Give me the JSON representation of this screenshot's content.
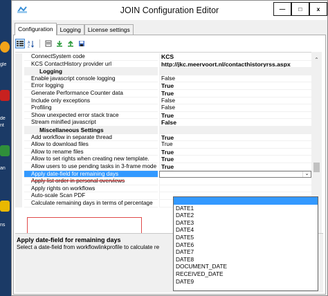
{
  "window": {
    "title": "JOIN Configuration Editor",
    "minimize_glyph": "—",
    "maximize_glyph": "□",
    "close_glyph": "x"
  },
  "tabs": [
    {
      "label": "Configuration",
      "active": true
    },
    {
      "label": "Logging",
      "active": false
    },
    {
      "label": "License settings",
      "active": false
    }
  ],
  "toolbar": {
    "icons": [
      "categorized-view-icon",
      "alphabetical-sort-icon",
      "property-pages-icon",
      "import-icon",
      "export-icon",
      "save-icon"
    ]
  },
  "grid": {
    "rows": [
      {
        "type": "prop",
        "name": "ConnectSystem code",
        "value": "KCS",
        "bold": true
      },
      {
        "type": "prop",
        "name": "KCS ContactHistory provider url",
        "value": "http://jkc.meervoort.nl/contacthistoryrss.aspx",
        "bold": true
      },
      {
        "type": "cat",
        "name": "Logging",
        "value": ""
      },
      {
        "type": "prop",
        "name": "Enable javascript console logging",
        "value": "False",
        "bold": false
      },
      {
        "type": "prop",
        "name": "Error logging",
        "value": "True",
        "bold": true
      },
      {
        "type": "prop",
        "name": "Generate Performance Counter data",
        "value": "True",
        "bold": true
      },
      {
        "type": "prop",
        "name": "Include only exceptions",
        "value": "False",
        "bold": false
      },
      {
        "type": "prop",
        "name": "Profiling",
        "value": "False",
        "bold": false
      },
      {
        "type": "prop",
        "name": "Show unexpected error stack trace",
        "value": "True",
        "bold": true
      },
      {
        "type": "prop",
        "name": "Stream minified javascript",
        "value": "False",
        "bold": true
      },
      {
        "type": "cat",
        "name": "Miscellaneous Settings",
        "value": ""
      },
      {
        "type": "prop",
        "name": "Add workflow in separate thread",
        "value": "True",
        "bold": true
      },
      {
        "type": "prop",
        "name": "Allow to download files",
        "value": "True",
        "bold": false
      },
      {
        "type": "prop",
        "name": "Allow to rename files",
        "value": "True",
        "bold": true
      },
      {
        "type": "prop",
        "name": "Allow to set rights when creating new template.",
        "value": "True",
        "bold": true
      },
      {
        "type": "prop",
        "name": "Allow users to use pending tasks in 3-frame mode",
        "value": "True",
        "bold": true
      },
      {
        "type": "prop",
        "name": "Apply date-field for remaining days",
        "value": "",
        "bold": false,
        "selected": true
      },
      {
        "type": "prop",
        "name": "Apply list order in personal overviews",
        "value": "",
        "bold": false
      },
      {
        "type": "prop",
        "name": "Apply rights on workflows",
        "value": "",
        "bold": false
      },
      {
        "type": "prop",
        "name": "Auto-scale Scan PDF",
        "value": "",
        "bold": false
      },
      {
        "type": "prop",
        "name": "Calculate remaining days in terms of percentage",
        "value": "",
        "bold": false
      }
    ]
  },
  "description": {
    "title": "Apply date-field for remaining days",
    "text": "Select a date-field from workflowlinkprofile to calculate re"
  },
  "dropdown": {
    "items": [
      "",
      "DATE1",
      "DATE2",
      "DATE3",
      "DATE4",
      "DATE5",
      "DATE6",
      "DATE7",
      "DATE8",
      "DOCUMENT_DATE",
      "RECEIVED_DATE",
      "DATE9"
    ],
    "highlighted_index": 0
  },
  "desktop": {
    "labels": [
      "e",
      "gle",
      "m",
      "de",
      "nt",
      "an",
      "ns"
    ]
  }
}
